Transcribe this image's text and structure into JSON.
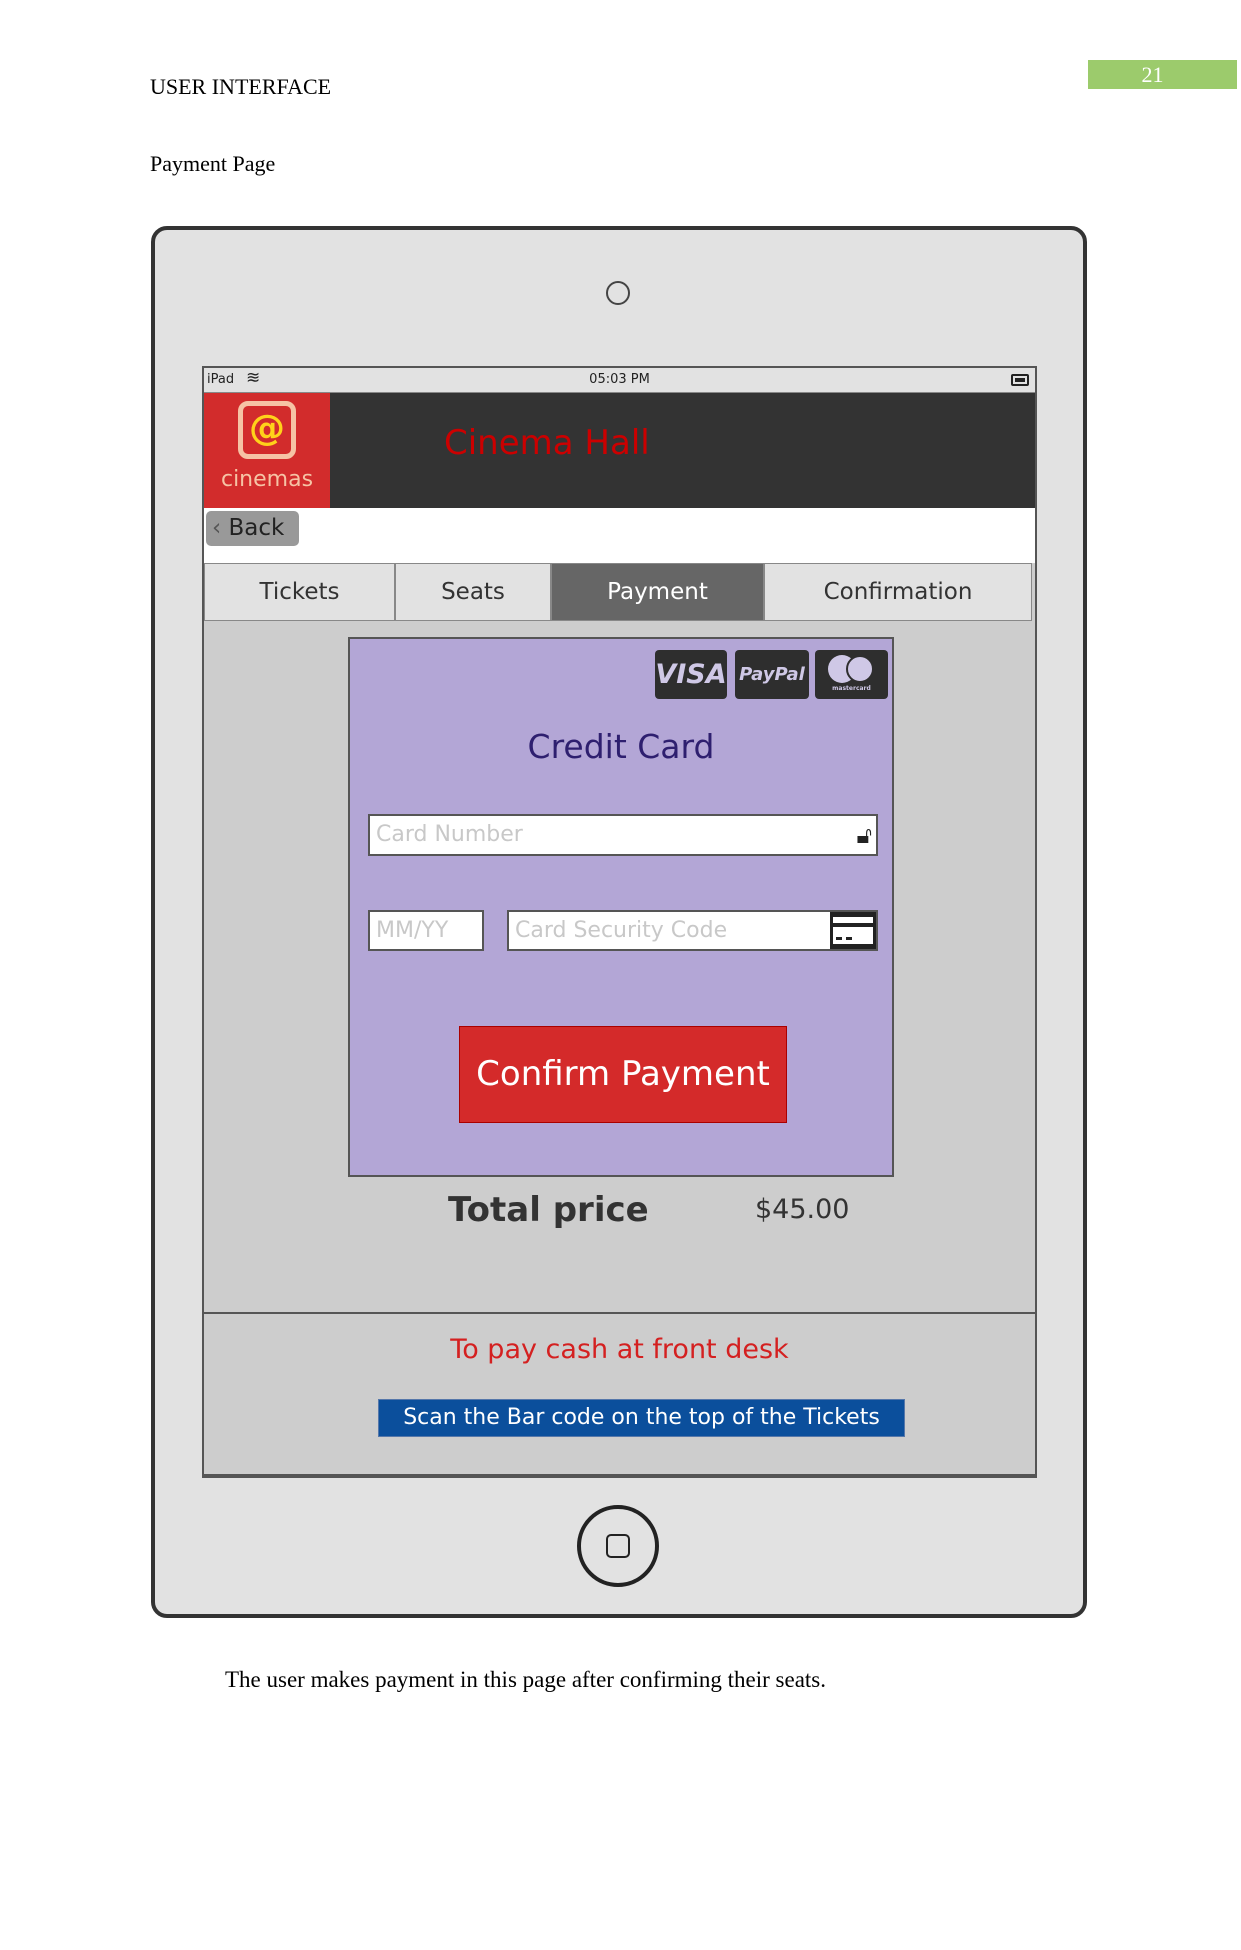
{
  "document": {
    "header": "USER INTERFACE",
    "page_number": "21",
    "section_title": "Payment Page",
    "caption": "The user makes payment in this page after confirming their seats."
  },
  "status_bar": {
    "device": "iPad",
    "time": "05:03 PM"
  },
  "app": {
    "logo_text": "cinemas",
    "logo_symbol": "@",
    "title": "Cinema Hall",
    "back_label": "Back"
  },
  "tabs": [
    {
      "label": "Tickets"
    },
    {
      "label": "Seats"
    },
    {
      "label": "Payment",
      "active": true
    },
    {
      "label": "Confirmation"
    }
  ],
  "payment": {
    "card_logos": [
      "VISA",
      "PayPal",
      "mastercard"
    ],
    "title": "Credit Card",
    "card_number_placeholder": "Card Number",
    "expiry_placeholder": "MM/YY",
    "csc_placeholder": "Card Security Code",
    "confirm_label": "Confirm Payment",
    "total_label": "Total price",
    "total_value": "$45.00"
  },
  "footer": {
    "cash_text": "To pay cash at front desk",
    "scan_text": "Scan the Bar code on the top of the Tickets"
  },
  "colors": {
    "accent_red": "#d42a2a",
    "panel": "#b3a6d6",
    "scan_blue": "#0b4f9c",
    "page_badge": "#9ccb6c"
  }
}
